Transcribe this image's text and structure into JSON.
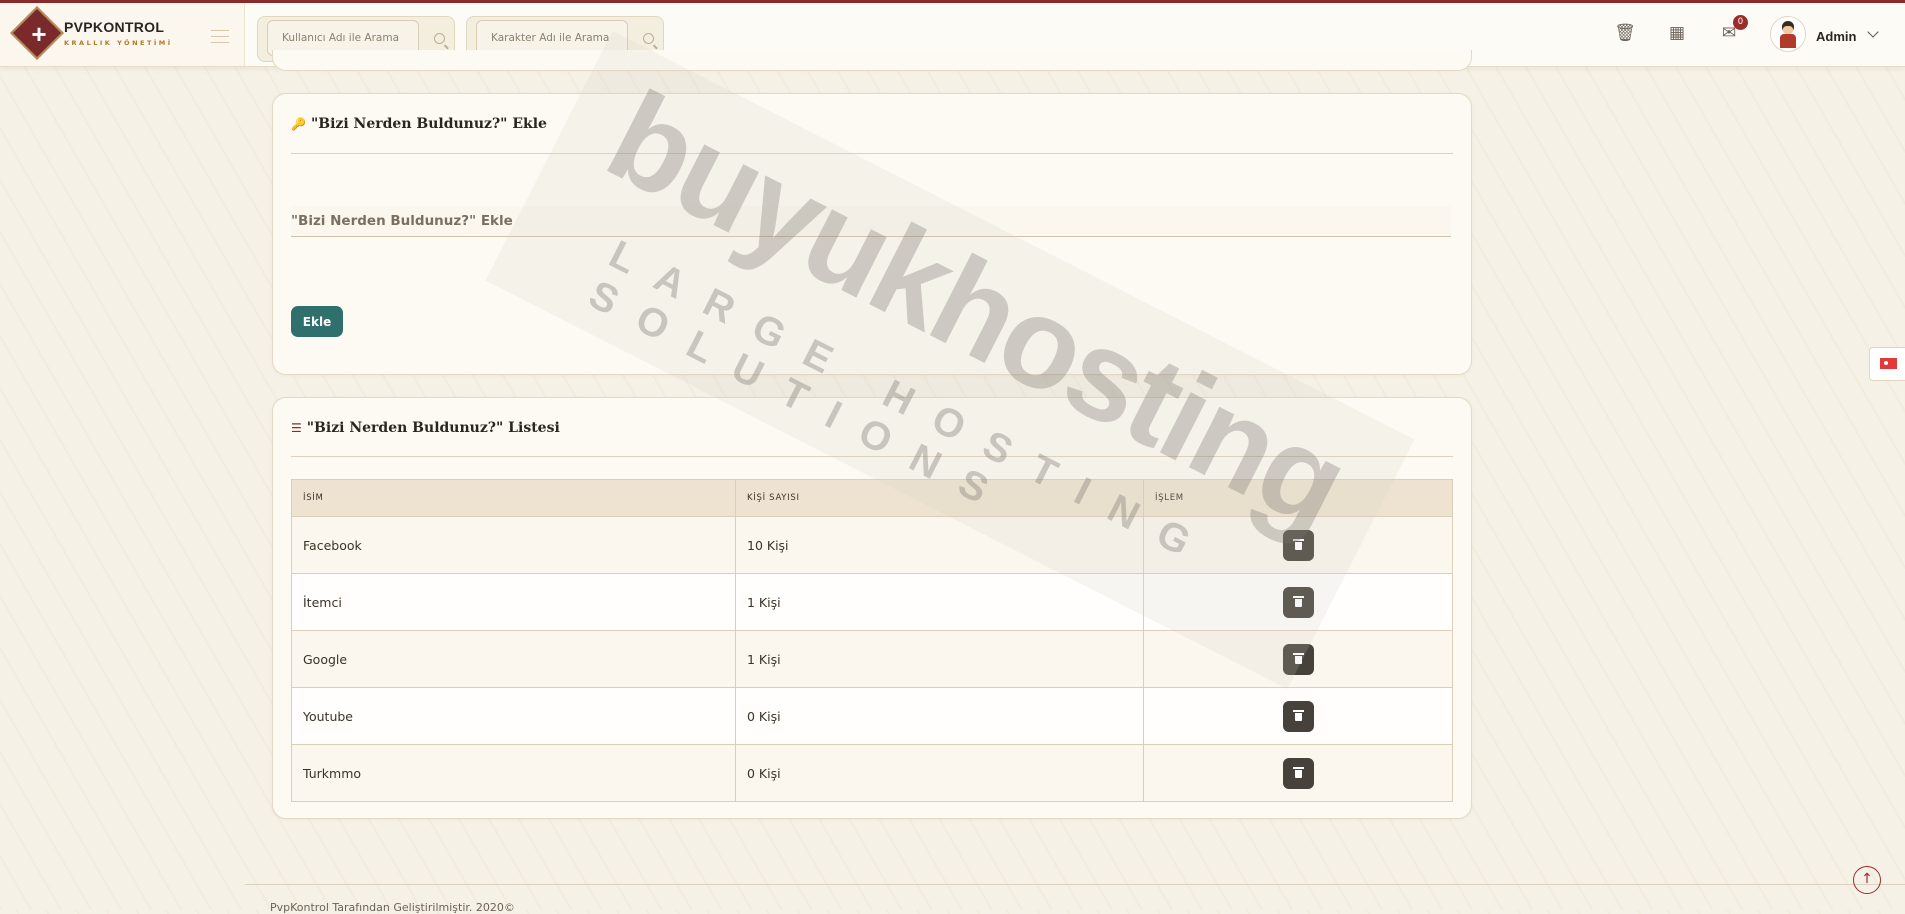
{
  "app": {
    "brand_name": "PVPKONTROL",
    "brand_subtitle": "KRALLIK YÖNETİMİ",
    "accent": "#8b2a2a",
    "button_color": "#2f6f6c"
  },
  "header": {
    "user_search_placeholder": "Kullanıcı Adı ile Arama",
    "character_search_placeholder": "Karakter Adı ile Arama",
    "icons": [
      "trash-icon",
      "calendar-icon",
      "mail-icon"
    ],
    "notification_count": "0",
    "user_name": "Admin"
  },
  "add_card": {
    "title": "\"Bizi Nerden Buldunuz?\" Ekle",
    "input_placeholder": "\"Bizi Nerden Buldunuz?\" Ekle",
    "input_value": "",
    "submit_label": "Ekle"
  },
  "list_card": {
    "title": "\"Bizi Nerden Buldunuz?\" Listesi",
    "columns": [
      "İSİM",
      "KİŞİ SAYISI",
      "İŞLEM"
    ],
    "rows": [
      {
        "name": "Facebook",
        "count": "10 Kişi"
      },
      {
        "name": "İtemci",
        "count": "1 Kişi"
      },
      {
        "name": "Google",
        "count": "1 Kişi"
      },
      {
        "name": "Youtube",
        "count": "0 Kişi"
      },
      {
        "name": "Turkmmo",
        "count": "0 Kişi"
      }
    ]
  },
  "watermark": {
    "main": "buyukhosting",
    "sub": "LARGE HOSTING SOLUTIONS"
  },
  "footer": {
    "text": "PvpKontrol Tarafından Geliştirilmiştir. 2020©"
  }
}
